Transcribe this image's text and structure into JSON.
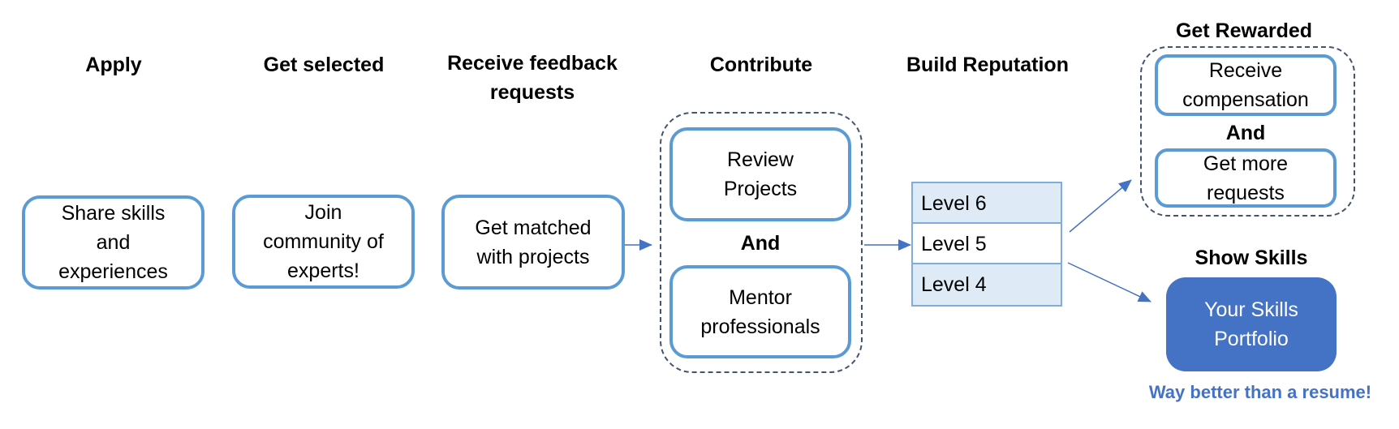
{
  "colors": {
    "box_border": "#5B9BD5",
    "dashed_border": "#44546A",
    "arrow": "#4472C4",
    "level_fill": "#DEEBF7",
    "progress_arrow": "#DE8A2B",
    "portfolio_fill": "#4472C4",
    "tagline": "#4472C4"
  },
  "steps": [
    {
      "title": "Apply",
      "box_lines": [
        "Share skills",
        "and",
        "experiences"
      ]
    },
    {
      "title": "Get selected",
      "box_lines": [
        "Join",
        "community of",
        "experts!"
      ]
    },
    {
      "title_lines": [
        "Receive feedback",
        "requests"
      ],
      "box_lines": [
        "Get matched",
        "with projects"
      ]
    },
    {
      "title": "Contribute",
      "items": [
        {
          "lines": [
            "Review",
            "Projects"
          ]
        },
        {
          "lines": [
            "Mentor",
            "professionals"
          ]
        }
      ],
      "connector": "And"
    },
    {
      "title": "Build Reputation",
      "levels": [
        "Level 6",
        "Level 5",
        "Level 4"
      ],
      "progress_icon": "up-arrow-icon"
    }
  ],
  "rewarded": {
    "title": "Get Rewarded",
    "items": [
      {
        "lines": [
          "Receive",
          "compensation"
        ]
      },
      {
        "lines": [
          "Get more",
          "requests"
        ]
      }
    ],
    "connector": "And"
  },
  "show_skills": {
    "title": "Show Skills",
    "portfolio_lines": [
      "Your Skills",
      "Portfolio"
    ],
    "tagline": "Way better than a resume!"
  }
}
